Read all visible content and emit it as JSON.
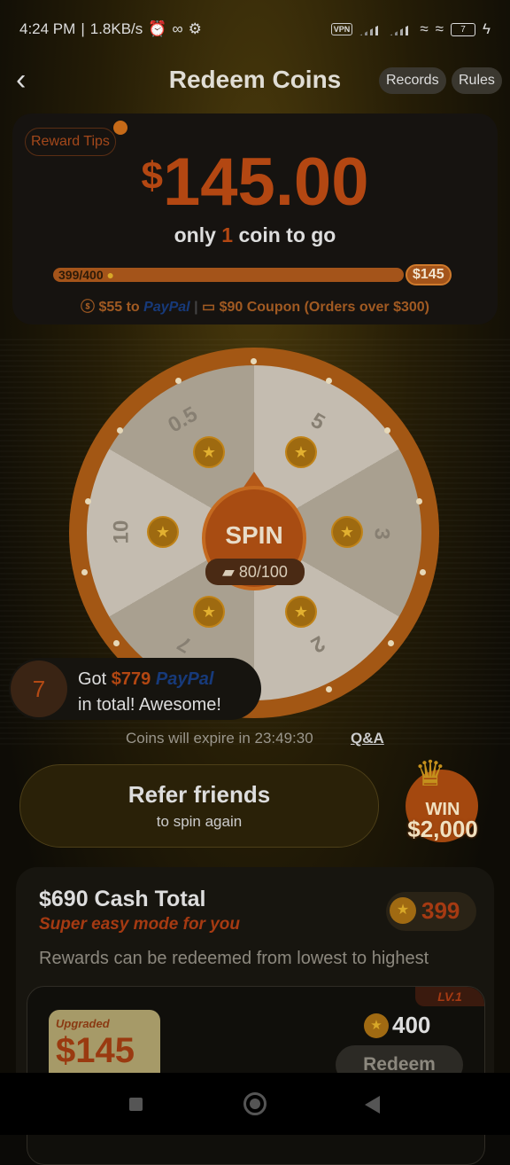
{
  "status": {
    "time": "4:24 PM",
    "speed": "1.8KB/s",
    "icons_left": [
      "alarm-icon",
      "infinity-icon",
      "gear-icon"
    ],
    "vpn": "VPN",
    "battery": "7"
  },
  "header": {
    "title": "Redeem Coins",
    "records": "Records",
    "rules": "Rules"
  },
  "reward": {
    "tips": "Reward Tips",
    "currency": "$",
    "amount": "145.00",
    "togo_pre": "only ",
    "togo_num": "1",
    "togo_post": " coin to go",
    "progress_label": "399/400",
    "progress_fraction": 0.9975,
    "goal": "$145",
    "paypal_part1": "$55 to ",
    "paypal_brand": "PayPal",
    "coupon": "$90 Coupon (Orders over $300)"
  },
  "wheel": {
    "labels": [
      "0.5",
      "5",
      "3",
      "2",
      "7",
      "10"
    ],
    "spin": "SPIN",
    "spins_left": "80/100"
  },
  "toast": {
    "num": "7",
    "got": "Got ",
    "amount": "$779",
    "brand": " PayPal",
    "line2": "in total! Awesome!"
  },
  "expire": "Coins will expire in 23:49:30",
  "qa": "Q&A",
  "refer": {
    "title": "Refer friends",
    "sub": "to spin again"
  },
  "win": {
    "label": "WIN",
    "amount": "$2,000"
  },
  "cash": {
    "title": "$690 Cash Total",
    "subtitle": "Super easy mode for you",
    "balance": "399",
    "note": "Rewards can be redeemed from lowest to highest",
    "tier": {
      "level": "LV.1",
      "upgraded": "Upgraded",
      "value": "$145",
      "cost": "400",
      "redeem": "Redeem"
    }
  },
  "colors": {
    "accent": "#b34712",
    "paypal": "#173a7a"
  }
}
